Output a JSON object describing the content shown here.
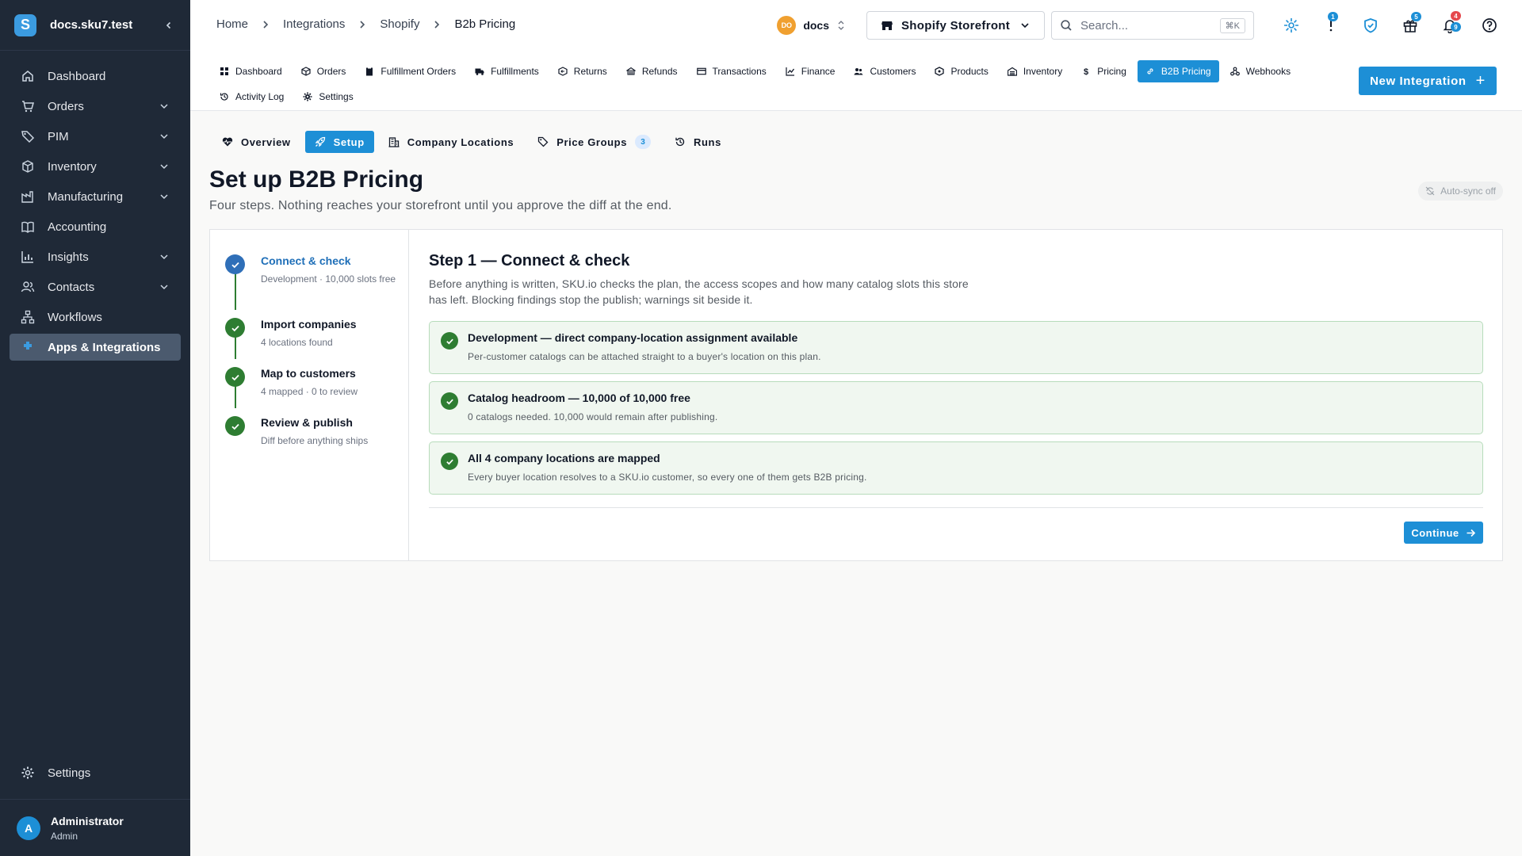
{
  "sidebar": {
    "workspace": "docs.sku7.test",
    "items": [
      {
        "label": "Dashboard",
        "icon": "home-icon"
      },
      {
        "label": "Orders",
        "icon": "cart-icon"
      },
      {
        "label": "PIM",
        "icon": "tag-icon"
      },
      {
        "label": "Inventory",
        "icon": "box-icon"
      },
      {
        "label": "Manufacturing",
        "icon": "factory-icon"
      },
      {
        "label": "Accounting",
        "icon": "book-icon"
      },
      {
        "label": "Insights",
        "icon": "chart-icon"
      },
      {
        "label": "Contacts",
        "icon": "people-icon"
      },
      {
        "label": "Workflows",
        "icon": "workflow-icon"
      },
      {
        "label": "Apps & Integrations",
        "icon": "apps-icon"
      }
    ],
    "settings_label": "Settings",
    "user": {
      "initial": "A",
      "name": "Administrator",
      "role": "Admin"
    }
  },
  "breadcrumb": [
    "Home",
    "Integrations",
    "Shopify",
    "B2b Pricing"
  ],
  "header": {
    "store_initials": "DO",
    "store_name": "docs",
    "storefront_label": "Shopify Storefront",
    "search_placeholder": "Search...",
    "search_shortcut": "⌘K",
    "badges": {
      "alerts": "1",
      "gifts": "5",
      "notif_red": "4",
      "notif_blue": "9"
    }
  },
  "integration_tabs": [
    {
      "label": "Dashboard",
      "icon": "grid-icon"
    },
    {
      "label": "Orders",
      "icon": "package-icon"
    },
    {
      "label": "Fulfillment Orders",
      "icon": "clipboard-icon"
    },
    {
      "label": "Fulfillments",
      "icon": "truck-icon"
    },
    {
      "label": "Returns",
      "icon": "return-icon"
    },
    {
      "label": "Refunds",
      "icon": "refund-icon"
    },
    {
      "label": "Transactions",
      "icon": "card-icon"
    },
    {
      "label": "Finance",
      "icon": "finance-icon"
    },
    {
      "label": "Customers",
      "icon": "customers-icon"
    },
    {
      "label": "Products",
      "icon": "product-icon"
    },
    {
      "label": "Inventory",
      "icon": "warehouse-icon"
    },
    {
      "label": "Pricing",
      "icon": "dollar-icon"
    },
    {
      "label": "B2B Pricing",
      "icon": "link-icon"
    },
    {
      "label": "Webhooks",
      "icon": "webhook-icon"
    },
    {
      "label": "Activity Log",
      "icon": "history-icon"
    },
    {
      "label": "Settings",
      "icon": "gear-icon"
    }
  ],
  "new_integration_label": "New Integration",
  "page_tabs": [
    {
      "label": "Overview"
    },
    {
      "label": "Setup"
    },
    {
      "label": "Company Locations"
    },
    {
      "label": "Price Groups",
      "count": "3"
    },
    {
      "label": "Runs"
    }
  ],
  "page": {
    "title": "Set up B2B Pricing",
    "subtitle": "Four steps. Nothing reaches your storefront until you approve the diff at the end.",
    "autosync_label": "Auto-sync off"
  },
  "wizard": {
    "steps": [
      {
        "title": "Connect & check",
        "desc": "Development · 10,000 slots free"
      },
      {
        "title": "Import companies",
        "desc": "4 locations found"
      },
      {
        "title": "Map to customers",
        "desc": "4 mapped · 0 to review"
      },
      {
        "title": "Review & publish",
        "desc": "Diff before anything ships"
      }
    ],
    "detail_title": "Step 1 — Connect & check",
    "detail_desc": "Before anything is written, SKU.io checks the plan, the access scopes and how many catalog slots this store has left. Blocking findings stop the publish; warnings sit beside it.",
    "checks": [
      {
        "title": "Development — direct company-location assignment available",
        "desc": "Per-customer catalogs can be attached straight to a buyer's location on this plan."
      },
      {
        "title": "Catalog headroom — 10,000 of 10,000 free",
        "desc": "0 catalogs needed. 10,000 would remain after publishing."
      },
      {
        "title": "All 4 company locations are mapped",
        "desc": "Every buyer location resolves to a SKU.io customer, so every one of them gets B2B pricing."
      }
    ],
    "continue_label": "Continue"
  },
  "colors": {
    "accent": "#1d8fd6",
    "sidebar": "#1f2937",
    "success": "#2e7d32",
    "step_current": "#2f6fb8"
  }
}
